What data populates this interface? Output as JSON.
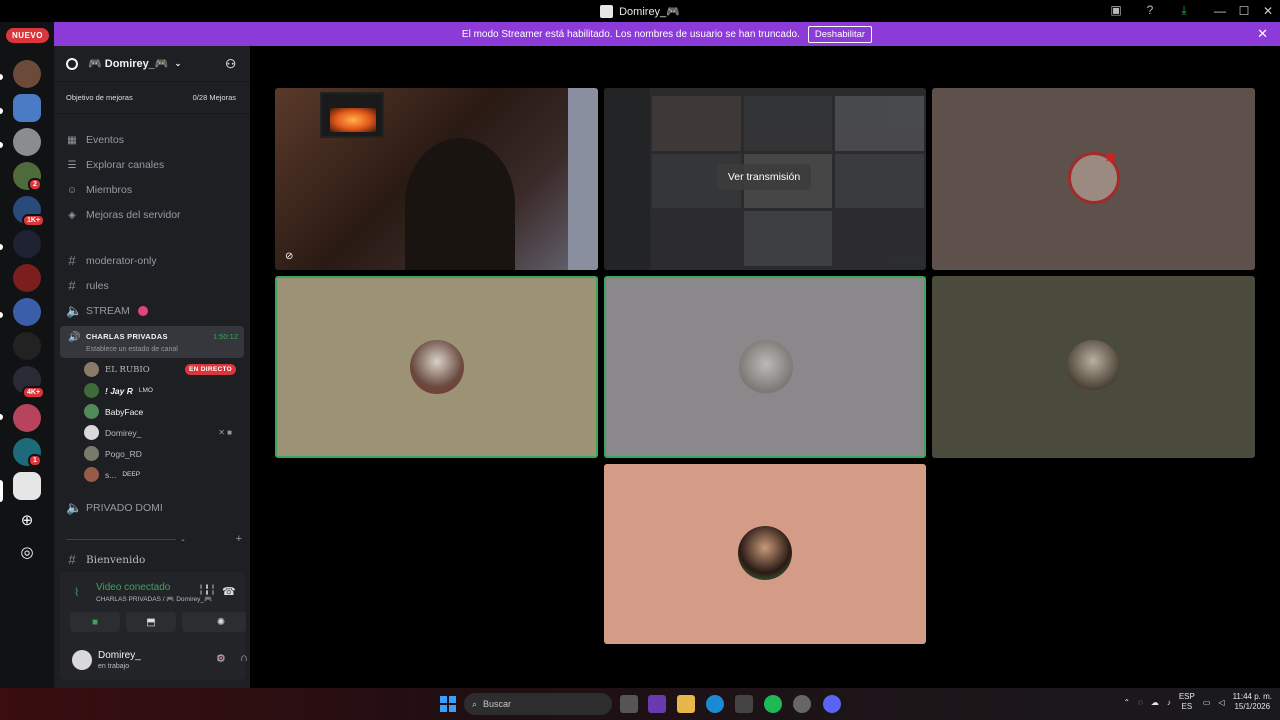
{
  "window": {
    "title": "Domirey_🎮"
  },
  "banner": {
    "message": "El modo Streamer está habilitado. Los nombres de usuario se han truncado.",
    "disable_label": "Deshabilitar"
  },
  "guilds": {
    "new_label": "NUEVO",
    "badges": [
      "2",
      "1K+",
      "4K+",
      "1"
    ]
  },
  "server": {
    "name": "🎮 Domirey_🎮",
    "goal_label": "Objetivo de mejoras",
    "goal_progress": "0/28 Mejoras",
    "nav": [
      {
        "label": "Eventos",
        "icon": "calendar-icon"
      },
      {
        "label": "Explorar canales",
        "icon": "browse-channels-icon"
      },
      {
        "label": "Miembros",
        "icon": "members-icon"
      },
      {
        "label": "Mejoras del servidor",
        "icon": "boost-icon"
      }
    ],
    "channels": [
      {
        "label": "moderator-only",
        "type": "text"
      },
      {
        "label": "rules",
        "type": "text"
      },
      {
        "label": "STREAM",
        "type": "voice"
      }
    ],
    "active_voice": {
      "name": "CHARLAS PRIVADAS",
      "time": "1:50:12",
      "status": "Establece un estado de canal"
    },
    "voice_members": [
      {
        "name": "EL RUBIO",
        "extra": "EN DIRECTO"
      },
      {
        "name": "! Jay R",
        "extra": "LMO"
      },
      {
        "name": "BabyFace",
        "extra": ""
      },
      {
        "name": "Domirey_",
        "extra": ""
      },
      {
        "name": "Pogo_RD",
        "extra": ""
      },
      {
        "name": "s...",
        "extra": "DEEP"
      }
    ],
    "more_channels": [
      {
        "label": "PRIVADO DOMI",
        "type": "voice"
      },
      {
        "label": "Bienvenido",
        "type": "text"
      }
    ]
  },
  "voice_panel": {
    "title": "Video conectado",
    "subtitle": "CHARLAS PRIVADAS / 🎮 Domirey_🎮"
  },
  "user": {
    "name": "Domirey_",
    "status": "en trabajo"
  },
  "stage": {
    "watch_stream_label": "Ver transmisión",
    "tiles": [
      {
        "id": "cam",
        "bg": "#3a2a22"
      },
      {
        "id": "stream",
        "bg": "#2a2b2d"
      },
      {
        "id": "tile3",
        "bg": "#5e504b"
      },
      {
        "id": "tile4",
        "bg": "#9c9275"
      },
      {
        "id": "tile5",
        "bg": "#8b888b"
      },
      {
        "id": "tile6",
        "bg": "#4a4b3d"
      },
      {
        "id": "tile7",
        "bg": "#d49b87"
      }
    ]
  },
  "taskbar": {
    "search_placeholder": "Buscar",
    "lang_top": "ESP",
    "lang_bottom": "ES",
    "time": "11:44 p. m.",
    "date": "15/1/2026"
  },
  "colors": {
    "accent_green": "#3ba55c",
    "streamer_purple": "#8c3bd9",
    "live_red": "#da373c"
  }
}
